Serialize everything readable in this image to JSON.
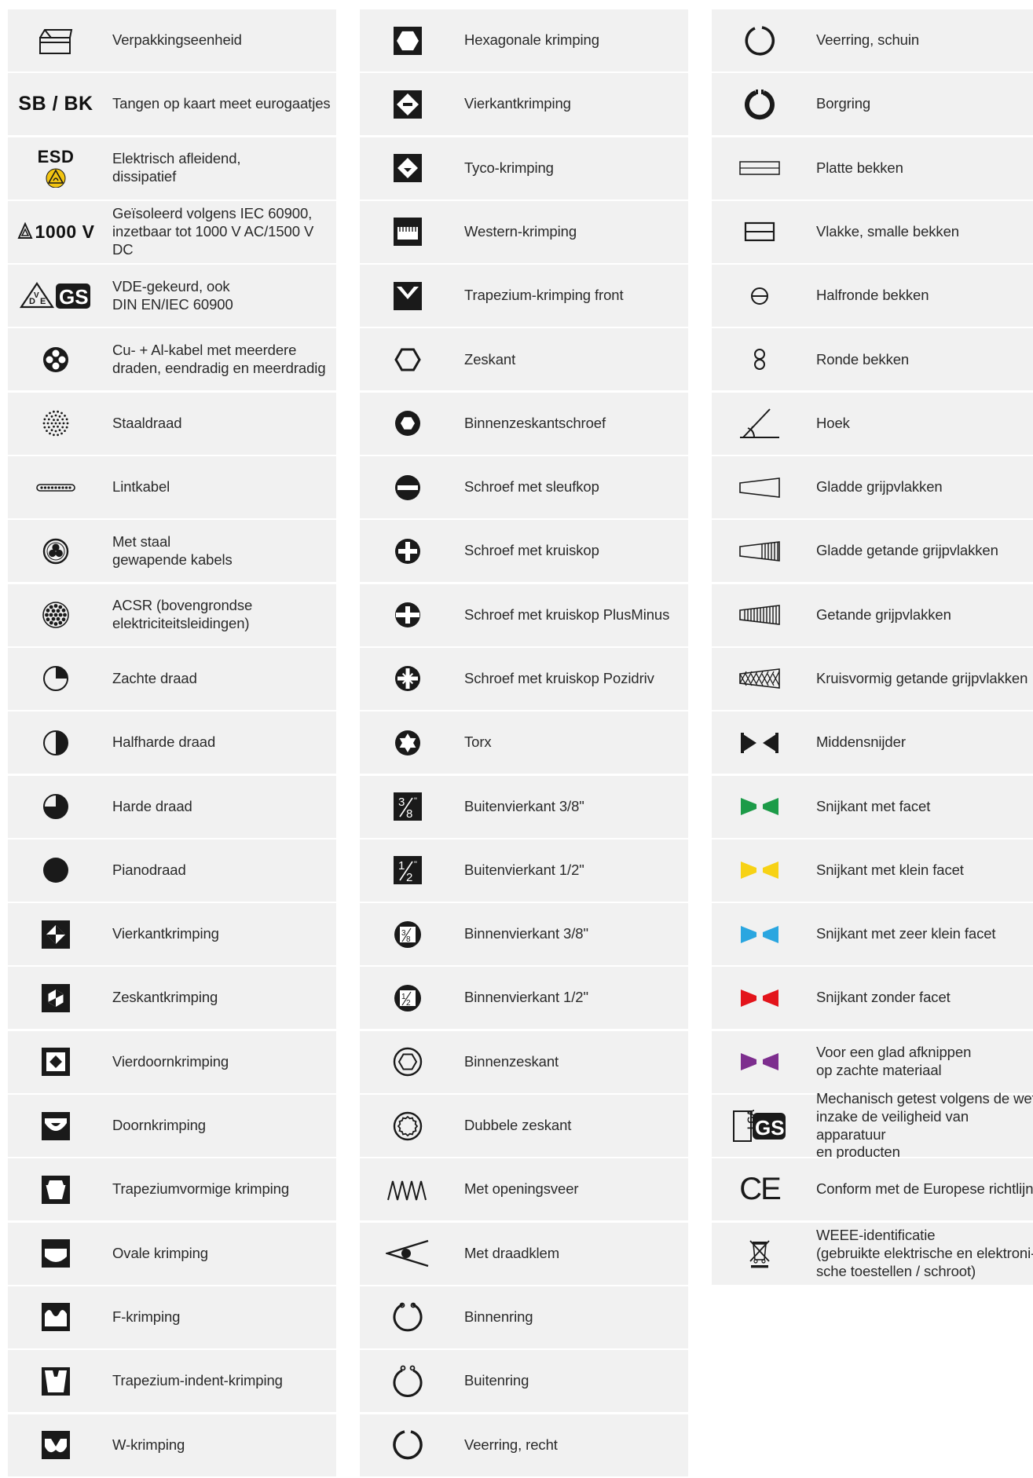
{
  "legend": {
    "columns": [
      [
        {
          "icon": "packaging-box-icon",
          "label": "Verpakkingseenheid"
        },
        {
          "icon": "sb-bk-text-icon",
          "icon_text": "SB / BK",
          "label": "Tangen op kaart meet eurogaatjes"
        },
        {
          "icon": "esd-warning-icon",
          "icon_text": "ESD",
          "label": "Elektrisch afleidend,\ndissipatief"
        },
        {
          "icon": "insulated-1000v-icon",
          "icon_text": "1000 V",
          "label": "Geïsoleerd volgens IEC 60900,\ninzetbaar tot 1000 V AC/1500 V DC"
        },
        {
          "icon": "vde-gs-mark-icon",
          "icon_text": "DVE",
          "label": "VDE-gekeurd, ook\nDIN EN/IEC 60900"
        },
        {
          "icon": "multi-strand-cable-icon",
          "label": "Cu- + Al-kabel met meerdere\ndraden, eendradig en meerdradig"
        },
        {
          "icon": "steel-wire-icon",
          "label": "Staaldraad"
        },
        {
          "icon": "ribbon-cable-icon",
          "label": "Lintkabel"
        },
        {
          "icon": "armoured-cable-icon",
          "label": "Met staal\ngewapende kabels"
        },
        {
          "icon": "acsr-cable-icon",
          "label": "ACSR (bovengrondse\nelektriciteitsleidingen)"
        },
        {
          "icon": "soft-wire-icon",
          "label": "Zachte draad"
        },
        {
          "icon": "medium-hard-wire-icon",
          "label": "Halfharde draad"
        },
        {
          "icon": "hard-wire-icon",
          "label": "Harde draad"
        },
        {
          "icon": "piano-wire-icon",
          "label": "Pianodraad"
        },
        {
          "icon": "square-crimp-icon",
          "label": "Vierkantkrimping"
        },
        {
          "icon": "hex-crimp-icon",
          "label": "Zeskantkrimping"
        },
        {
          "icon": "four-mandrel-crimp-icon",
          "label": "Vierdoornkrimping"
        },
        {
          "icon": "mandrel-crimp-icon",
          "label": "Doornkrimping"
        },
        {
          "icon": "trapezoid-crimp-icon",
          "label": "Trapeziumvormige krimping"
        },
        {
          "icon": "oval-crimp-icon",
          "label": "Ovale krimping"
        },
        {
          "icon": "f-crimp-icon",
          "label": "F-krimping"
        },
        {
          "icon": "trapezoid-indent-crimp-icon",
          "label": "Trapezium-indent-krimping"
        },
        {
          "icon": "w-crimp-icon",
          "label": "W-krimping"
        }
      ],
      [
        {
          "icon": "hexagonal-crimp-icon",
          "label": "Hexagonale krimping"
        },
        {
          "icon": "square-crimp-2-icon",
          "label": "Vierkantkrimping"
        },
        {
          "icon": "tyco-crimp-icon",
          "label": " Tyco-krimping"
        },
        {
          "icon": "western-crimp-icon",
          "label": "Western-krimping"
        },
        {
          "icon": "trapezoid-crimp-front-icon",
          "label": "Trapezium-krimping front"
        },
        {
          "icon": "hexagon-nut-icon",
          "label": "Zeskant"
        },
        {
          "icon": "hex-socket-screw-icon",
          "label": "Binnenzeskantschroef"
        },
        {
          "icon": "slotted-screw-icon",
          "label": "Schroef met sleufkop"
        },
        {
          "icon": "phillips-screw-icon",
          "label": "Schroef met kruiskop"
        },
        {
          "icon": "plusminus-screw-icon",
          "label": "Schroef met kruiskop PlusMinus"
        },
        {
          "icon": "pozidriv-screw-icon",
          "label": "Schroef met kruiskop Pozidriv"
        },
        {
          "icon": "torx-icon",
          "label": "Torx"
        },
        {
          "icon": "outer-square-38-icon",
          "icon_text": "3/8\"",
          "label": "Buitenvierkant 3/8\""
        },
        {
          "icon": "outer-square-12-icon",
          "icon_text": "1/2\"",
          "label": "Buitenvierkant 1/2\""
        },
        {
          "icon": "inner-square-38-icon",
          "icon_text": "3/8\"",
          "label": "Binnenvierkant 3/8\""
        },
        {
          "icon": "inner-square-12-icon",
          "icon_text": "1/2\"",
          "label": "Binnenvierkant 1/2\""
        },
        {
          "icon": "inner-hex-icon",
          "label": "Binnenzeskant"
        },
        {
          "icon": "double-hex-icon",
          "label": "Dubbele zeskant"
        },
        {
          "icon": "opening-spring-icon",
          "label": "Met openingsveer"
        },
        {
          "icon": "wire-clamp-icon",
          "label": "Met draadklem"
        },
        {
          "icon": "internal-circlip-icon",
          "label": "Binnenring"
        },
        {
          "icon": "external-circlip-icon",
          "label": "Buitenring"
        },
        {
          "icon": "straight-spring-ring-icon",
          "label": "Veerring, recht"
        }
      ],
      [
        {
          "icon": "angled-spring-ring-icon",
          "label": "Veerring, schuin"
        },
        {
          "icon": "retaining-ring-icon",
          "label": "Borgring"
        },
        {
          "icon": "flat-jaws-icon",
          "label": "Platte bekken"
        },
        {
          "icon": "flat-narrow-jaws-icon",
          "label": "Vlakke, smalle bekken"
        },
        {
          "icon": "half-round-jaws-icon",
          "label": "Halfronde bekken"
        },
        {
          "icon": "round-jaws-icon",
          "label": "Ronde bekken"
        },
        {
          "icon": "angle-icon",
          "label": "Hoek"
        },
        {
          "icon": "smooth-gripping-icon",
          "label": "Gladde grijpvlakken"
        },
        {
          "icon": "smooth-serrated-gripping-icon",
          "label": "Gladde getande grijpvlakken"
        },
        {
          "icon": "serrated-gripping-icon",
          "label": "Getande grijpvlakken"
        },
        {
          "icon": "cross-serrated-gripping-icon",
          "label": "Kruisvormig getande grijpvlakken"
        },
        {
          "icon": "center-cutter-icon",
          "label": "Middensnijder"
        },
        {
          "icon": "bevel-cutting-edge-icon",
          "label": "Snijkant met facet"
        },
        {
          "icon": "small-bevel-cutting-edge-icon",
          "label": "Snijkant met klein facet"
        },
        {
          "icon": "very-small-bevel-cutting-edge-icon",
          "label": "Snijkant met zeer klein facet"
        },
        {
          "icon": "no-bevel-cutting-edge-icon",
          "label": "Snijkant zonder facet"
        },
        {
          "icon": "soft-material-cutting-edge-icon",
          "label": "Voor een glad afknippen\nop zachte materiaal"
        },
        {
          "icon": "lga-gs-mark-icon",
          "icon_text": "LGA",
          "label": "Mechanisch getest volgens de wet\ninzake de veiligheid van apparatuur\nen producten"
        },
        {
          "icon": "ce-mark-icon",
          "icon_text": "CE",
          "label": "Conform met de Europese richtlijn"
        },
        {
          "icon": "weee-icon",
          "label": "WEEE-identificatie\n(gebruikte elektrische en elektroni-\nsche toestellen / schroot)"
        }
      ]
    ]
  },
  "colors": {
    "row_bg": "#f1f1f1",
    "icon": "#1a1a1a",
    "green": "#1c9b48",
    "yellow": "#f7d215",
    "blue": "#2aa6e0",
    "red": "#e3141b",
    "purple": "#7d2e8e",
    "esd_yellow": "#f2c411"
  }
}
